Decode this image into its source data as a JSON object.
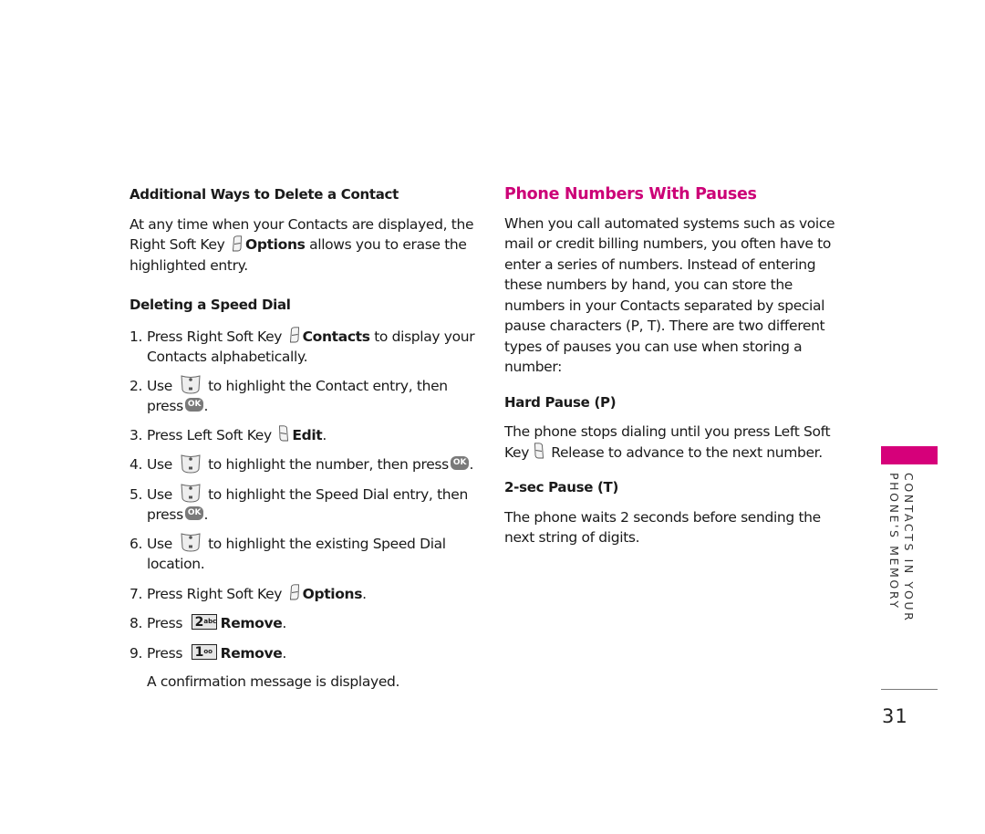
{
  "left_column": {
    "section1": {
      "heading": "Additional Ways to Delete a Contact",
      "para_before": "At any time when your Contacts are displayed, the Right Soft Key",
      "para_bold": "Options",
      "para_after": "allows you to erase the highlighted entry."
    },
    "section2": {
      "heading": "Deleting a Speed Dial",
      "steps": [
        {
          "num": "1.",
          "before": "Press Right Soft Key",
          "bold": "Contacts",
          "after": "to display your Contacts alphabetically."
        },
        {
          "num": "2.",
          "before": "Use",
          "after": "to highlight the Contact entry, then press",
          "end": "."
        },
        {
          "num": "3.",
          "before": "Press Left Soft Key",
          "bold": "Edit",
          "after": "."
        },
        {
          "num": "4.",
          "before": "Use",
          "after": "to highlight the number, then press",
          "end": "."
        },
        {
          "num": "5.",
          "before": "Use",
          "after": "to highlight the Speed Dial entry, then press",
          "end": "."
        },
        {
          "num": "6.",
          "before": "Use",
          "after": "to highlight the existing Speed Dial location."
        },
        {
          "num": "7.",
          "before": "Press Right Soft Key",
          "bold": "Options",
          "after": "."
        },
        {
          "num": "8.",
          "before": "Press",
          "key_main": "2",
          "key_sub": "abc",
          "bold": "Remove",
          "after": "."
        },
        {
          "num": "9.",
          "before": "Press",
          "key_main": "1",
          "key_sub": "oo",
          "bold": "Remove",
          "after": "."
        }
      ],
      "note": "A confirmation message is displayed."
    }
  },
  "right_column": {
    "heading": "Phone Numbers With Pauses",
    "intro": "When you call automated systems such as voice mail or credit billing numbers, you often have to enter a series of numbers. Instead of entering these numbers by hand, you can store the numbers in your Contacts separated by special pause characters (P, T). There are two different types of pauses you can use when storing a number:",
    "hard_pause": {
      "heading": "Hard Pause (P)",
      "text_before": "The phone stops dialing until you press Left Soft Key",
      "text_after": "Release to advance to the next number."
    },
    "two_sec_pause": {
      "heading": "2-sec Pause (T)",
      "text": "The phone waits 2 seconds before sending the next string of digits."
    }
  },
  "side_tab": {
    "line1": "CONTACTS IN YOUR",
    "line2": "PHONE'S MEMORY",
    "color": "#d6007a"
  },
  "ok_label": "OK",
  "page_number": "31",
  "colors": {
    "heading_accent": "#cc0077"
  }
}
